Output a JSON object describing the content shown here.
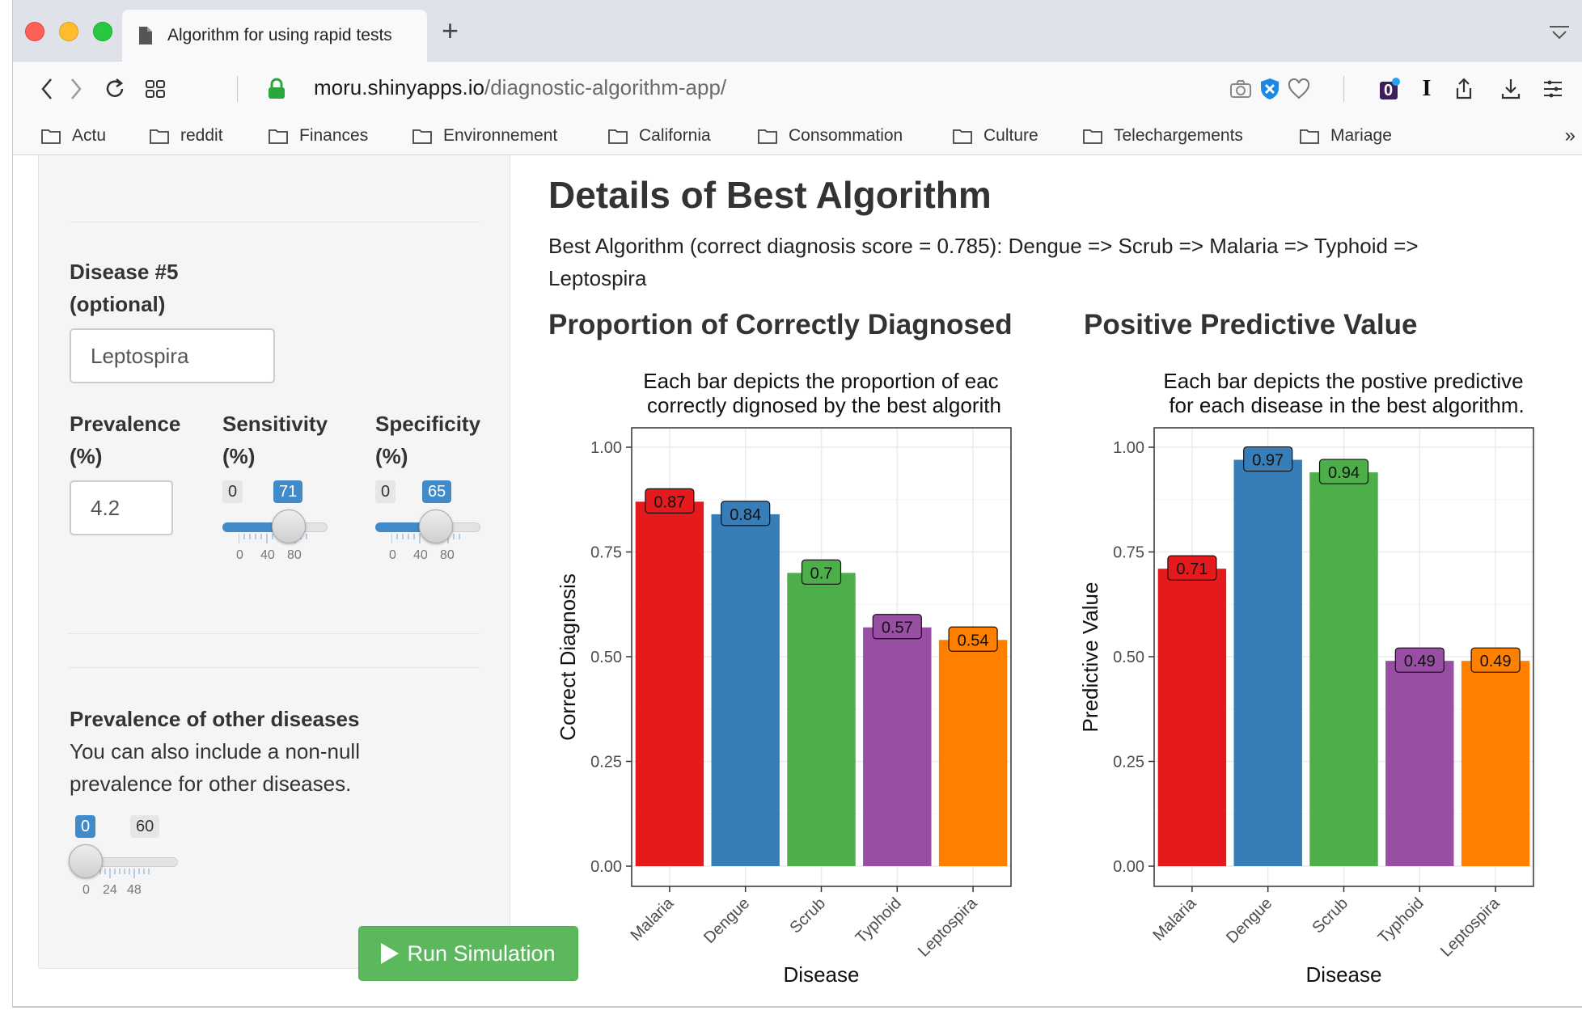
{
  "browser": {
    "tab_title": "Algorithm for using rapid tests",
    "new_tab": "+",
    "url_host": "moru.shinyapps.io",
    "url_path": "/diagnostic-algorithm-app/",
    "extension_badge": "0",
    "extension_i": "I",
    "bookmarks": [
      "Actu",
      "reddit",
      "Finances",
      "Environnement",
      "California",
      "Consommation",
      "Culture",
      "Telechargements",
      "Mariage"
    ],
    "bookmarks_more": "»"
  },
  "sidebar": {
    "disease5_label_1": "Disease #5",
    "disease5_label_2": "(optional)",
    "disease5_value": "Leptospira",
    "prevalence_label_1": "Prevalence",
    "prevalence_label_2": "(%)",
    "prevalence_value": "4.2",
    "sensitivity_label_1": "Sensitivity",
    "sensitivity_label_2": "(%)",
    "specificity_label_1": "Specificity",
    "specificity_label_2": "(%)",
    "sensitivity_slider": {
      "min_label": "0",
      "value": "71",
      "ticks": [
        "0",
        "40",
        "80"
      ]
    },
    "specificity_slider": {
      "min_label": "0",
      "value": "65",
      "ticks": [
        "0",
        "40",
        "80"
      ]
    },
    "other_title": "Prevalence of other diseases",
    "other_desc_1": "You can also include a non-null",
    "other_desc_2": "prevalence for other diseases.",
    "other_slider": {
      "value": "0",
      "max_label": "60",
      "ticks": [
        "0",
        "24",
        "48"
      ]
    },
    "run_button": "Run Simulation"
  },
  "main": {
    "title": "Details of Best Algorithm",
    "best_line_1": "Best Algorithm (correct diagnosis score = 0.785): Dengue => Scrub => Malaria => Typhoid =>",
    "best_line_2": "Leptospira",
    "left_title": "Proportion of Correctly Diagnosed",
    "right_title": "Positive Predictive Value"
  },
  "colors": {
    "Malaria": "#e41a1c",
    "Dengue": "#377eb8",
    "Scrub": "#4daf4a",
    "Typhoid": "#984ea3",
    "Leptospira": "#ff7f00"
  },
  "chart_data": [
    {
      "type": "bar",
      "subtitle_1": "Each bar depicts the proportion of eac",
      "subtitle_2": "correctly dignosed by the best algorith",
      "xlabel": "Disease",
      "ylabel": "Correct Diagnosis",
      "ylim": [
        0,
        1.0
      ],
      "yticks": [
        "0.00",
        "0.25",
        "0.50",
        "0.75",
        "1.00"
      ],
      "categories": [
        "Malaria",
        "Dengue",
        "Scrub",
        "Typhoid",
        "Leptospira"
      ],
      "values": [
        0.87,
        0.84,
        0.7,
        0.57,
        0.54
      ],
      "labels": [
        "0.87",
        "0.84",
        "0.7",
        "0.57",
        "0.54"
      ]
    },
    {
      "type": "bar",
      "subtitle_1": "Each bar depicts the postive predictive",
      "subtitle_2": "for each disease in the best algorithm.",
      "xlabel": "Disease",
      "ylabel": "Predictive Value",
      "ylim": [
        0,
        1.0
      ],
      "yticks": [
        "0.00",
        "0.25",
        "0.50",
        "0.75",
        "1.00"
      ],
      "categories": [
        "Malaria",
        "Dengue",
        "Scrub",
        "Typhoid",
        "Leptospira"
      ],
      "values": [
        0.71,
        0.97,
        0.94,
        0.49,
        0.49
      ],
      "labels": [
        "0.71",
        "0.97",
        "0.94",
        "0.49",
        "0.49"
      ]
    }
  ]
}
